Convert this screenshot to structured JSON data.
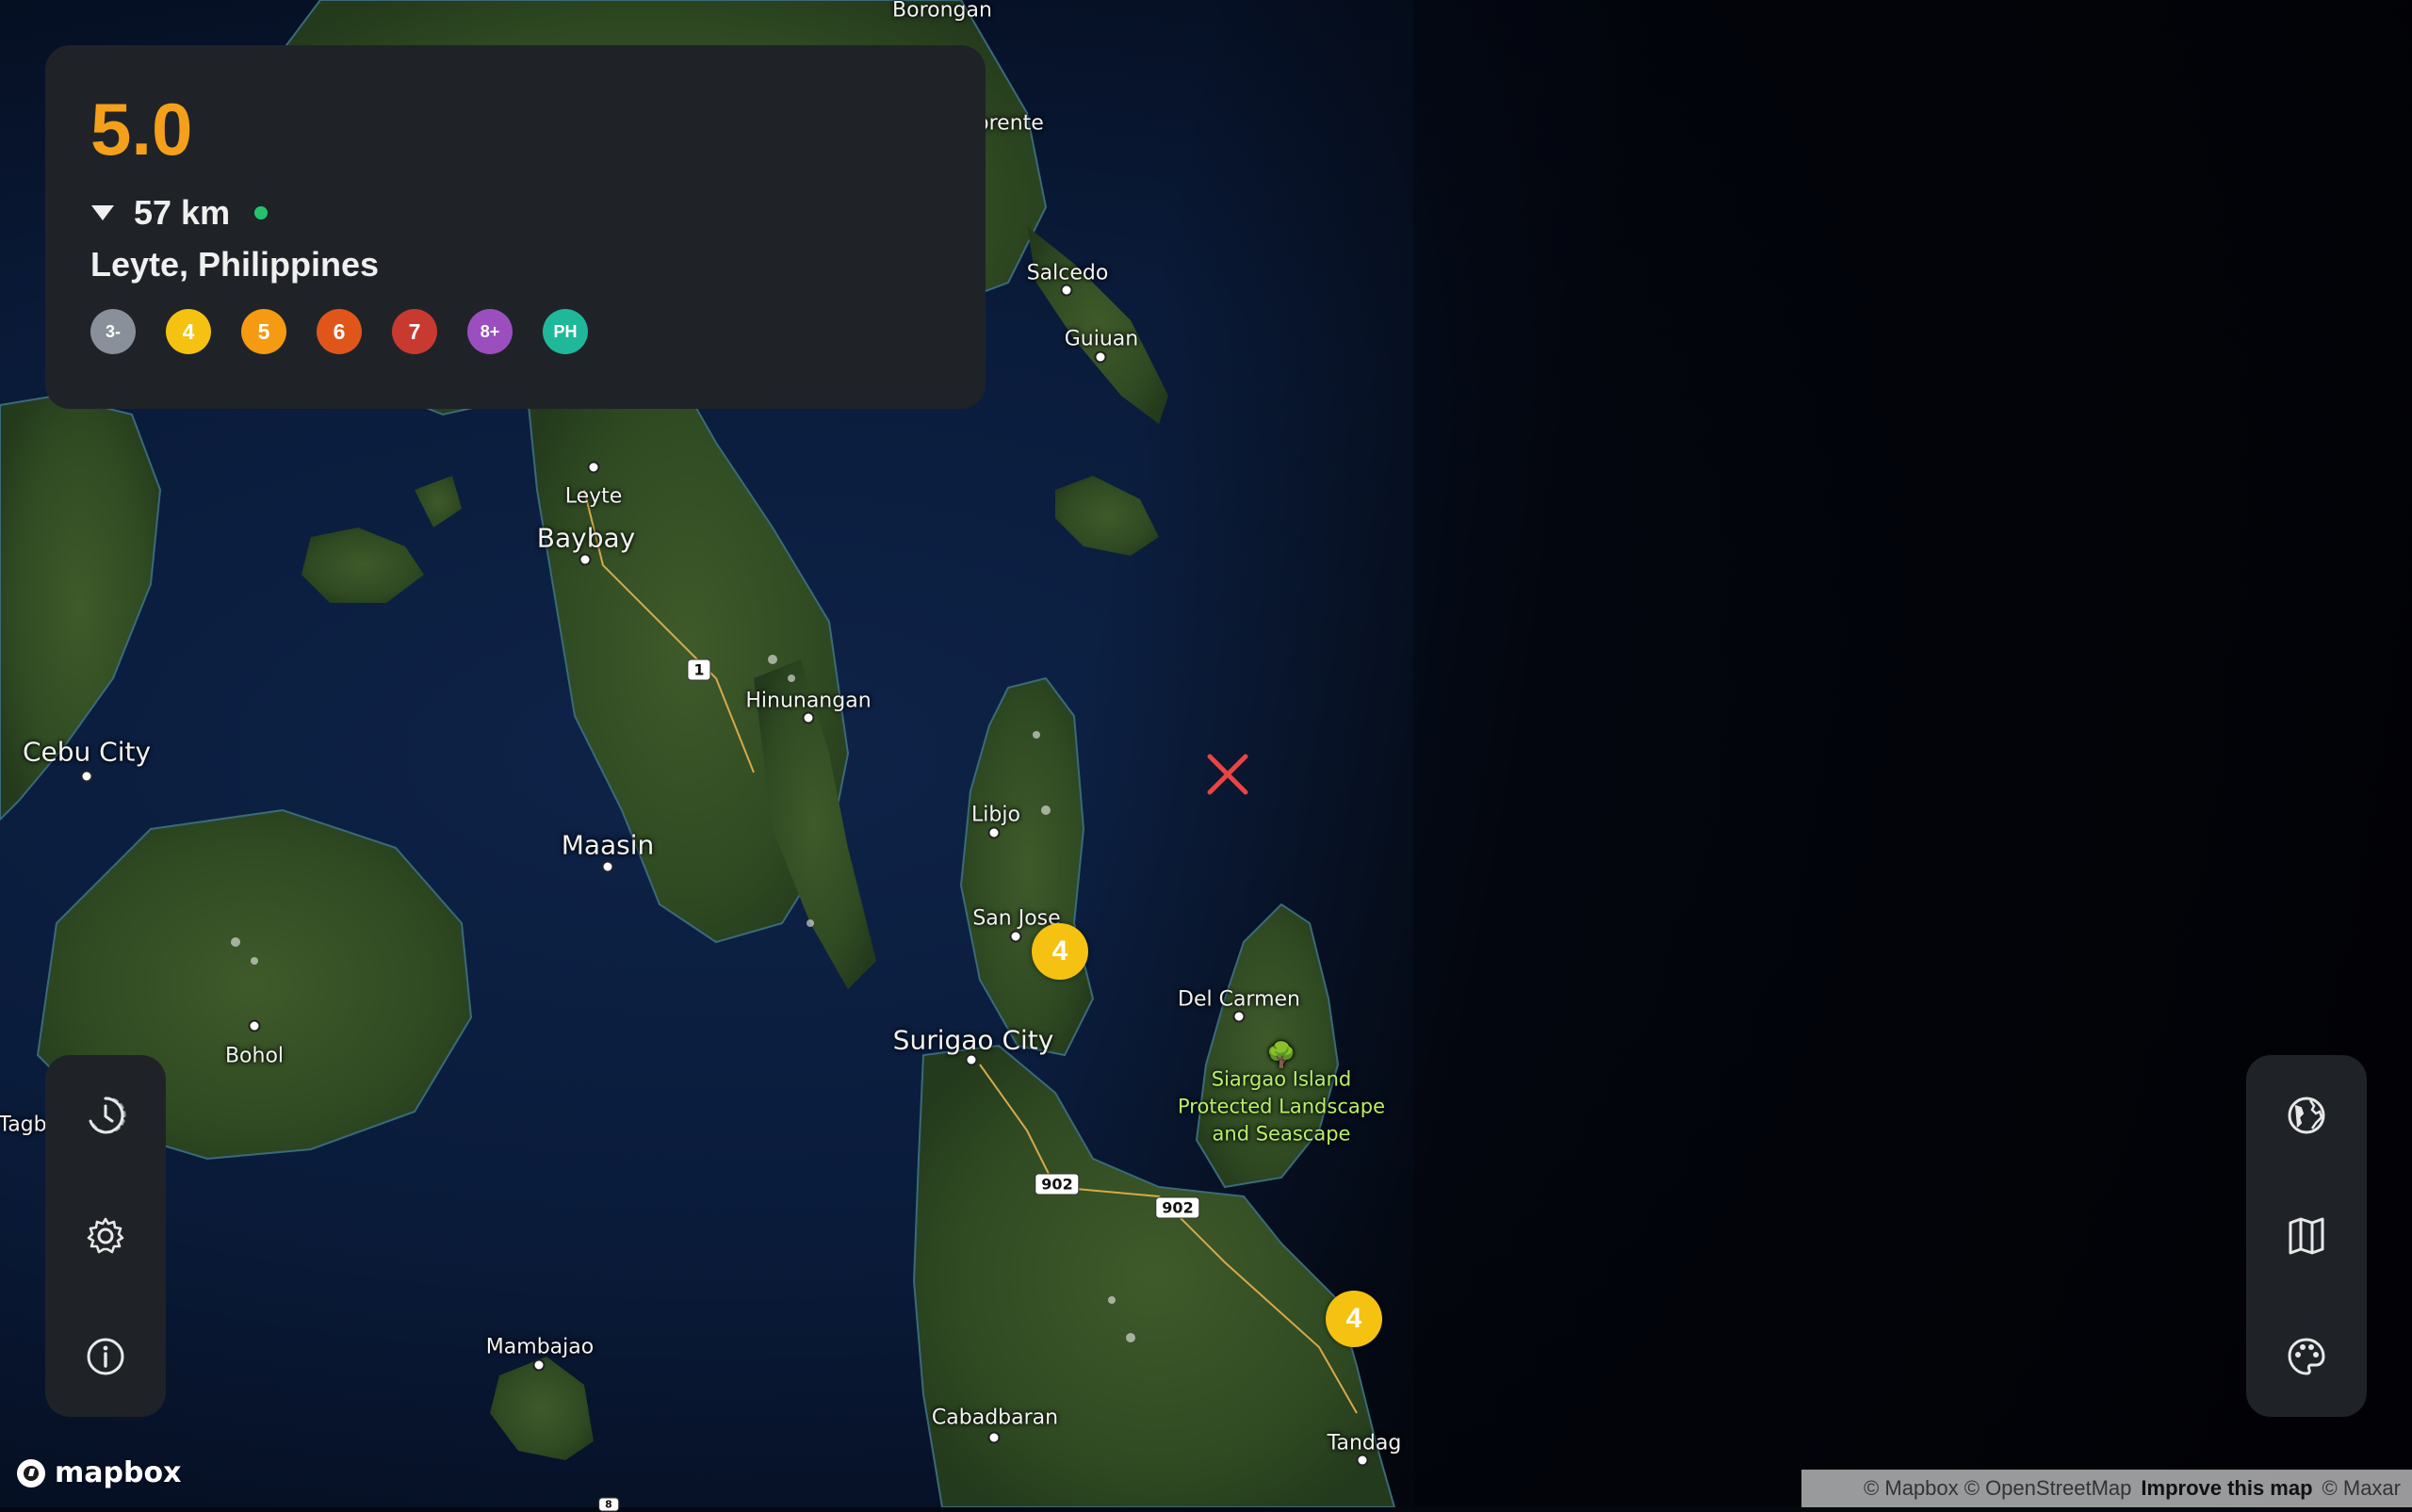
{
  "event": {
    "magnitude": "5.0",
    "depth": "57 km",
    "location": "Leyte, Philippines"
  },
  "intensity_scale": [
    {
      "label": "3-",
      "color": "#8a9099"
    },
    {
      "label": "4",
      "color": "#f5c211"
    },
    {
      "label": "5",
      "color": "#f59a11"
    },
    {
      "label": "6",
      "color": "#e0561a"
    },
    {
      "label": "7",
      "color": "#c83a2f"
    },
    {
      "label": "8+",
      "color": "#9b4fbf"
    },
    {
      "label": "PH",
      "color": "#1fb89a"
    }
  ],
  "map": {
    "places": [
      {
        "name": "Borongan"
      },
      {
        "name": "orente"
      },
      {
        "name": "Salcedo"
      },
      {
        "name": "Guiuan"
      },
      {
        "name": "Leyte"
      },
      {
        "name": "Baybay"
      },
      {
        "name": "Hinunangan"
      },
      {
        "name": "Cebu City"
      },
      {
        "name": "Maasin"
      },
      {
        "name": "Libjo"
      },
      {
        "name": "San Jose"
      },
      {
        "name": "Surigao City"
      },
      {
        "name": "Del Carmen"
      },
      {
        "name": "Bohol"
      },
      {
        "name": "Tagb"
      },
      {
        "name": "Mambajao"
      },
      {
        "name": "Cabadbaran"
      },
      {
        "name": "Tandag"
      }
    ],
    "park": [
      "Siargao Island",
      "Protected Landscape",
      "and Seascape"
    ],
    "road_shields": [
      "1",
      "902",
      "902",
      "8"
    ],
    "quake_markers": [
      "4",
      "4"
    ]
  },
  "left_toolbar": [
    "history-icon",
    "settings-icon",
    "info-icon"
  ],
  "right_toolbar": [
    "globe-icon",
    "map-icon",
    "palette-icon"
  ],
  "footer": {
    "logo": "mapbox",
    "attribution_1": "© Mapbox © OpenStreetMap",
    "attribution_link": "Improve this map",
    "attribution_2": "© Maxar"
  }
}
